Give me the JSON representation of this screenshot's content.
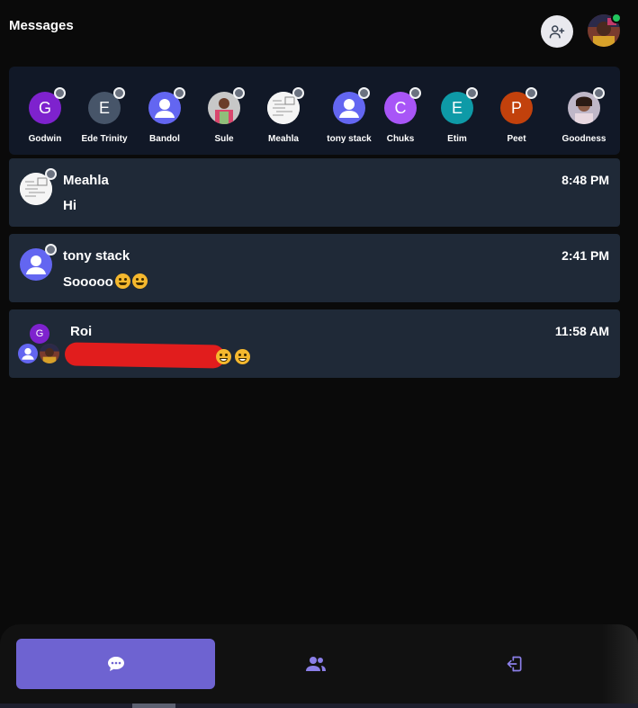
{
  "header": {
    "title": "Messages",
    "add_friend_icon": "user-plus-icon",
    "online_color": "#22c55e"
  },
  "stories": [
    {
      "name": "Godwin",
      "initial": "G",
      "color": "#7e22ce"
    },
    {
      "name": "Ede Trinity",
      "initial": "E",
      "color": "#475569"
    },
    {
      "name": "Bandol",
      "initial": "",
      "color": "#6366f1",
      "avatar": "default-user-icon"
    },
    {
      "name": "Sule",
      "initial": "",
      "color": "#9ca3af",
      "avatar": "photo"
    },
    {
      "name": "Meahla",
      "initial": "",
      "color": "#f3f4f6",
      "avatar": "sketch-photo"
    },
    {
      "name": "tony stack",
      "initial": "",
      "color": "#6366f1",
      "avatar": "default-user-icon"
    },
    {
      "name": "Chuks",
      "initial": "C",
      "color": "#a855f7"
    },
    {
      "name": "Etim",
      "initial": "E",
      "color": "#0e9aa7"
    },
    {
      "name": "Peet",
      "initial": "P",
      "color": "#c2410c"
    },
    {
      "name": "Goodness",
      "initial": "",
      "color": "#a1a1aa",
      "avatar": "photo"
    }
  ],
  "conversations": [
    {
      "name": "Meahla",
      "time": "8:48 PM",
      "message": "Hi"
    },
    {
      "name": "tony stack",
      "time": "2:41 PM",
      "message": "Sooooo",
      "emojis": [
        "smirk",
        "pleading"
      ]
    },
    {
      "name": "Roi",
      "time": "11:58 AM",
      "message": "",
      "group_initial": "G",
      "emojis": [
        "grin",
        "grin"
      ]
    }
  ],
  "nav": [
    {
      "name": "chats",
      "icon": "chat-icon",
      "active": true
    },
    {
      "name": "friends",
      "icon": "users-icon",
      "active": false
    },
    {
      "name": "logout",
      "icon": "logout-icon",
      "active": false
    }
  ],
  "colors": {
    "accent": "#6e63d1",
    "card": "#1f2937",
    "strip": "#111827",
    "redaction": "#e11d1d"
  }
}
